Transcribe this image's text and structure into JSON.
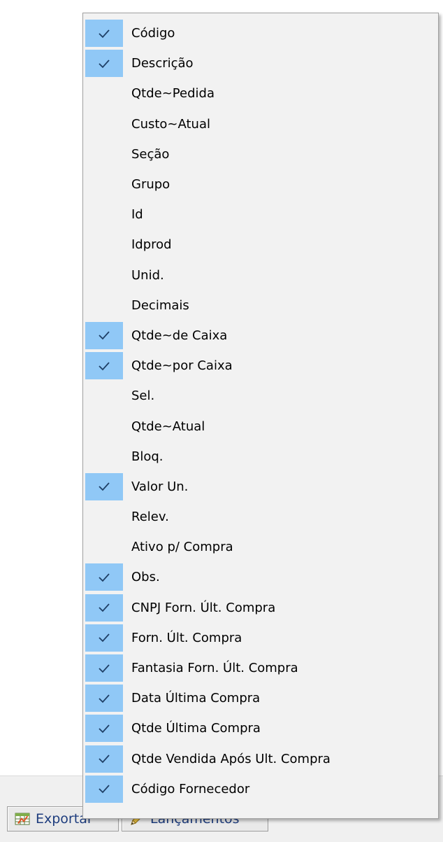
{
  "column_menu": {
    "items": [
      {
        "label": "Código",
        "checked": true
      },
      {
        "label": "Descrição",
        "checked": true
      },
      {
        "label": "Qtde~Pedida",
        "checked": false
      },
      {
        "label": "Custo~Atual",
        "checked": false
      },
      {
        "label": "Seção",
        "checked": false
      },
      {
        "label": "Grupo",
        "checked": false
      },
      {
        "label": "Id",
        "checked": false
      },
      {
        "label": "Idprod",
        "checked": false
      },
      {
        "label": "Unid.",
        "checked": false
      },
      {
        "label": "Decimais",
        "checked": false
      },
      {
        "label": "Qtde~de Caixa",
        "checked": true
      },
      {
        "label": "Qtde~por Caixa",
        "checked": true
      },
      {
        "label": "Sel.",
        "checked": false
      },
      {
        "label": "Qtde~Atual",
        "checked": false
      },
      {
        "label": "Bloq.",
        "checked": false
      },
      {
        "label": "Valor Un.",
        "checked": true
      },
      {
        "label": "Relev.",
        "checked": false
      },
      {
        "label": "Ativo p/ Compra",
        "checked": false
      },
      {
        "label": "Obs.",
        "checked": true
      },
      {
        "label": "CNPJ Forn. Últ. Compra",
        "checked": true
      },
      {
        "label": "Forn. Últ. Compra",
        "checked": true
      },
      {
        "label": "Fantasia Forn. Últ. Compra",
        "checked": true
      },
      {
        "label": "Data Última Compra",
        "checked": true
      },
      {
        "label": "Qtde Última Compra",
        "checked": true
      },
      {
        "label": "Qtde Vendida Após Ult. Compra",
        "checked": true
      },
      {
        "label": "Código Fornecedor",
        "checked": true
      }
    ]
  },
  "toolbar": {
    "exportar_label": "Exportar",
    "lancamentos_label": "Lançamentos"
  },
  "colors": {
    "check_highlight": "#90c8f6",
    "menu_background": "#f2f2f2",
    "toolbar_text": "#1d3c7d"
  }
}
